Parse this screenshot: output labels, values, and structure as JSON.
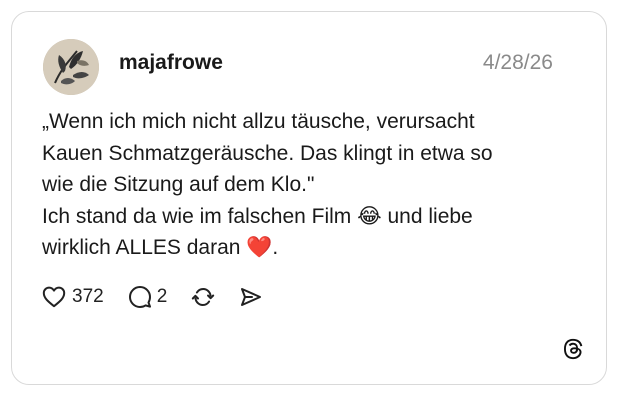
{
  "post": {
    "username": "majafrowe",
    "date": "4/28/26",
    "text": "„Wenn ich mich nicht allzu täusche, verursacht\nKauen Schmatzgeräusche. Das klingt in etwa so\nwie die Sitzung auf dem Klo.\"\nIch stand da wie im falschen Film 😂 und liebe\nwirklich ALLES daran ❤️."
  },
  "actions": {
    "likes": "372",
    "replies": "2"
  },
  "icons": {
    "avatar": "avatar-image",
    "like": "heart-icon",
    "reply": "comment-icon",
    "repost": "repost-icon",
    "share": "send-icon",
    "brand": "threads-logo-icon"
  },
  "colors": {
    "text": "#1a1a1a",
    "muted": "#8a8a8a",
    "border": "#d9d9d9"
  }
}
